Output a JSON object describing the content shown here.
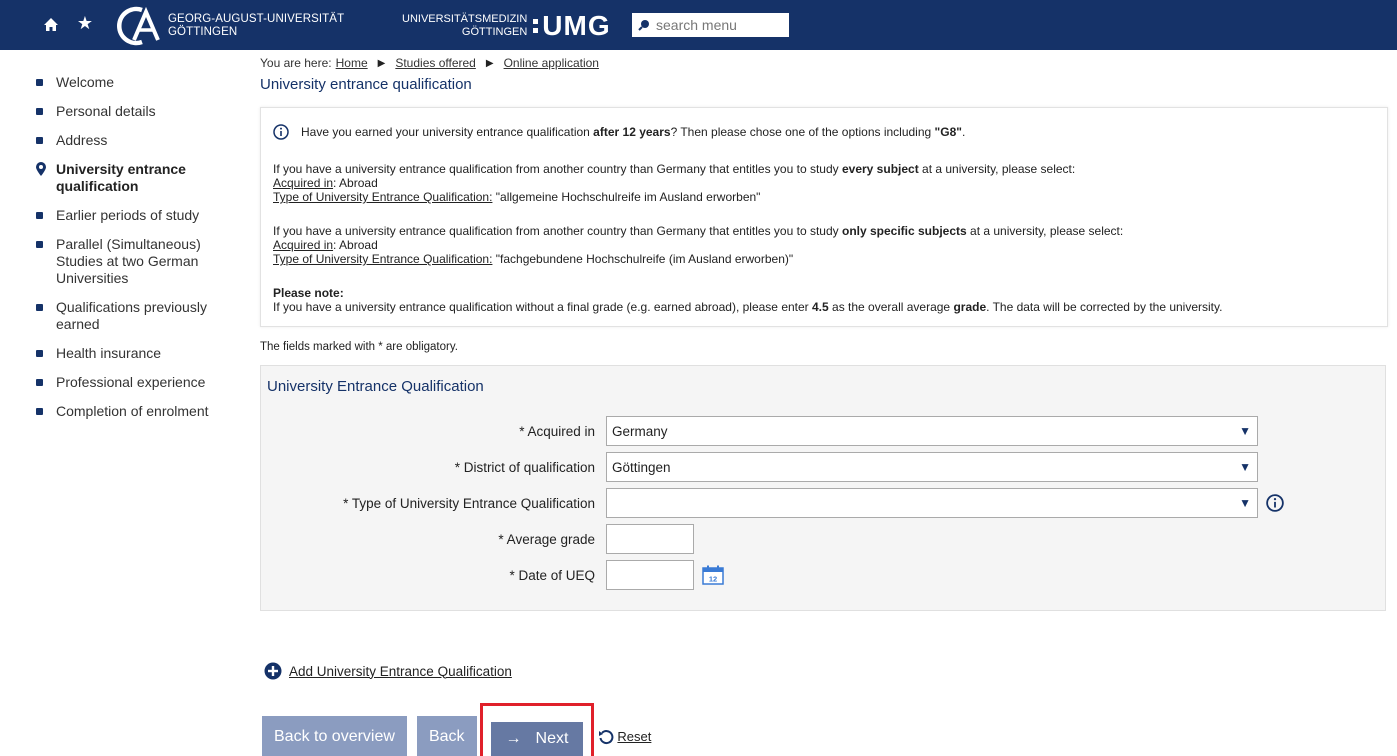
{
  "header": {
    "uni_name_line1": "GEORG-AUGUST-UNIVERSITÄT",
    "uni_name_line2": "GÖTTINGEN",
    "med_line1": "UNIVERSITÄTSMEDIZIN",
    "med_line2": "GÖTTINGEN",
    "umg": "UMG",
    "search_placeholder": "search menu",
    "brand_color": "#153268"
  },
  "sidebar": {
    "items": [
      {
        "label": "Welcome"
      },
      {
        "label": "Personal details"
      },
      {
        "label": "Address"
      },
      {
        "label": "University entrance qualification",
        "active": true
      },
      {
        "label": "Earlier periods of study"
      },
      {
        "label": "Parallel (Simultaneous) Studies at two German Universities"
      },
      {
        "label": "Qualifications previously earned"
      },
      {
        "label": "Health insurance"
      },
      {
        "label": "Professional experience"
      },
      {
        "label": "Completion of enrolment"
      }
    ]
  },
  "breadcrumb": {
    "prefix": "You are here:",
    "items": [
      "Home",
      "Studies offered",
      "Online application"
    ]
  },
  "page_title": "University entrance qualification",
  "info": {
    "line1_pre": "Have you earned your university entrance qualification ",
    "line1_bold": "after 12 years",
    "line1_mid": "? Then please chose one of the options including ",
    "line1_bold2": "\"G8\"",
    "line1_end": ".",
    "p2_pre": "If you have a university entrance qualification from another country than Germany that entitles you to study ",
    "p2_bold": "every subject",
    "p2_post": " at a university, please select:",
    "acquired_label": "Acquired in",
    "acquired_value": ": Abroad",
    "type_label": "Type of University Entrance Qualification:",
    "p2_type_value": " \"allgemeine Hochschulreife im Ausland erworben\"",
    "p3_pre": "If you have a university entrance qualification from another country than Germany that entitles you to study ",
    "p3_bold": "only specific subjects",
    "p3_post": " at a university, please select:",
    "p3_type_value": " \"fachgebundene Hochschulreife (im Ausland erworben)\"",
    "note_title": "Please note:",
    "note_pre": "If you have a university entrance qualification without a final grade (e.g. earned abroad), please enter ",
    "note_bold": "4.5",
    "note_mid": " as the  overall average ",
    "note_bold2": "grade",
    "note_post": ". The data will be corrected by the university."
  },
  "obligatory_text": "The fields marked with * are obligatory.",
  "form": {
    "title": "University Entrance Qualification",
    "acquired_in_label": "* Acquired in",
    "acquired_in_value": "Germany",
    "district_label": "* District of qualification",
    "district_value": "Göttingen",
    "type_label": "* Type of University Entrance Qualification",
    "type_value": "",
    "grade_label": "* Average grade",
    "date_label": "* Date of UEQ",
    "calendar_day": "12"
  },
  "add_link": "Add University Entrance Qualification",
  "buttons": {
    "back_overview": "Back to overview",
    "back": "Back",
    "next": "Next",
    "reset": "Reset"
  }
}
